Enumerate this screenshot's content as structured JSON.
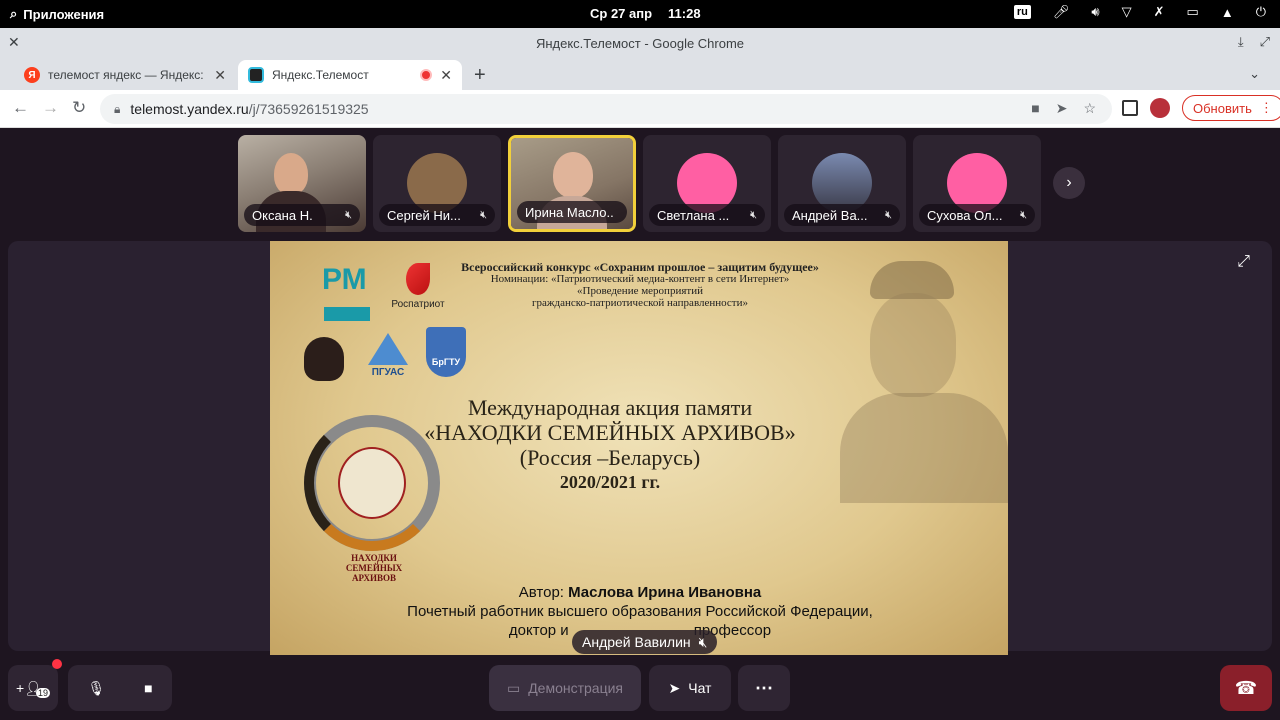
{
  "system": {
    "apps_label": "Приложения",
    "date": "Ср 27 апр",
    "time": "11:28",
    "keyboard_layout": "ru"
  },
  "window": {
    "title": "Яндекс.Телемост - Google Chrome"
  },
  "tabs": [
    {
      "label": "телемост яндекс — Яндекс: н"
    },
    {
      "label": "Яндекс.Телемост"
    }
  ],
  "address_bar": {
    "domain": "telemost.yandex.ru",
    "path": "/j/73659261519325",
    "update_label": "Обновить"
  },
  "participants": [
    {
      "name": "Оксана Н."
    },
    {
      "name": "Сергей Ни..."
    },
    {
      "name": "Ирина Масло..."
    },
    {
      "name": "Светлана ..."
    },
    {
      "name": "Андрей Ва..."
    },
    {
      "name": "Сухова Ол..."
    }
  ],
  "slide": {
    "logos": {
      "rm": "РМ",
      "rospatriot": "Роспатриот",
      "pguas": "ПГУАС",
      "brgtu": "БрГТУ"
    },
    "contest_title": "Всероссийский конкурс «Сохраним прошлое – защитим будущее»",
    "contest_nomination": "Номинации: «Патриотический медиа-контент в сети Интернет»",
    "contest_nomination2": "«Проведение мероприятий",
    "contest_nomination3": "гражданско-патриотической направленности»",
    "title_line1": "Международная акция памяти",
    "title_line2": "«НАХОДКИ СЕМЕЙНЫХ АРХИВОВ»",
    "title_line3": "(Россия –Беларусь)",
    "title_line4": "2020/2021 гг.",
    "medal_text": "НАХОДКИ СЕМЕЙНЫХ АРХИВОВ",
    "author_prefix": "Автор:",
    "author_name": "Маслова Ирина Ивановна",
    "author_line2": "Почетный работник высшего образования Российской Федерации,",
    "author_line3": "доктор и                              профессор"
  },
  "active_speaker": "Андрей Вавилин",
  "controls": {
    "participants_count": "19",
    "demo_label": "Демонстрация",
    "chat_label": "Чат"
  }
}
